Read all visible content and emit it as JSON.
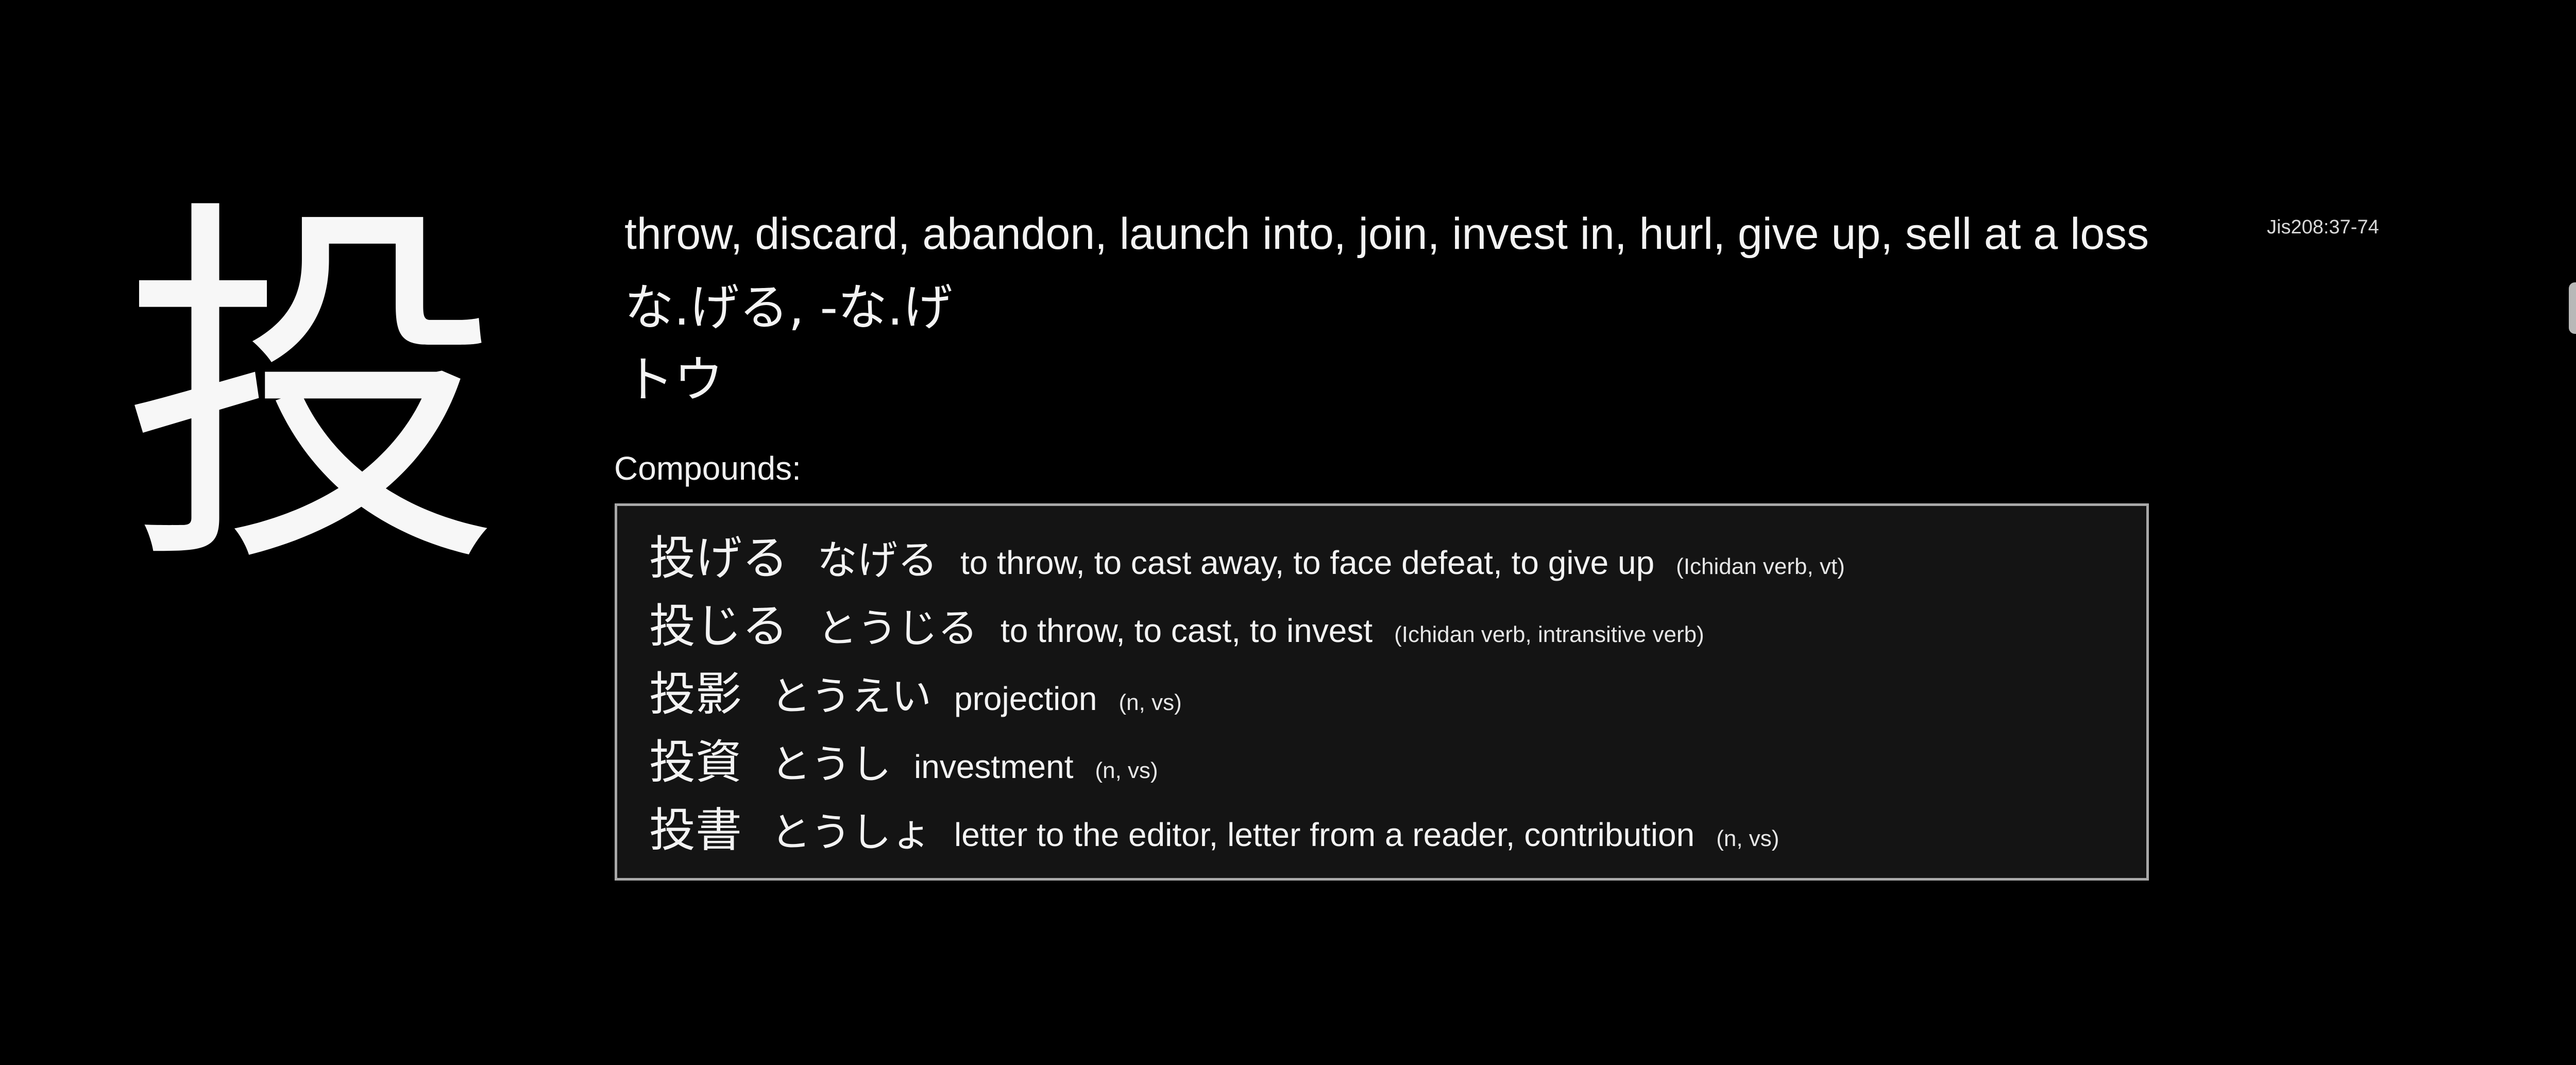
{
  "kanji": {
    "character": "投",
    "meanings": "throw, discard, abandon, launch into, join, invest in, hurl, give up, sell at a loss",
    "kun_readings": "な.げる, -な.げ",
    "on_readings": "トウ",
    "jis_code": "Jis208:37-74"
  },
  "compounds": {
    "label": "Compounds:",
    "items": [
      {
        "word": "投げる",
        "reading": "なげる",
        "meaning": "to throw, to cast away, to face defeat, to give up",
        "pos": "(Ichidan verb, vt)"
      },
      {
        "word": "投じる",
        "reading": "とうじる",
        "meaning": "to throw, to cast, to invest",
        "pos": "(Ichidan verb, intransitive verb)"
      },
      {
        "word": "投影",
        "reading": "とうえい",
        "meaning": "projection",
        "pos": "(n, vs)"
      },
      {
        "word": "投資",
        "reading": "とうし",
        "meaning": "investment",
        "pos": "(n, vs)"
      },
      {
        "word": "投書",
        "reading": "とうしょ",
        "meaning": "letter to the editor, letter from a reader, contribution",
        "pos": "(n, vs)"
      }
    ]
  },
  "colors": {
    "background": "#000000",
    "text": "#f3f3f3",
    "box_background": "#141414",
    "box_border": "#a8a8a8"
  }
}
